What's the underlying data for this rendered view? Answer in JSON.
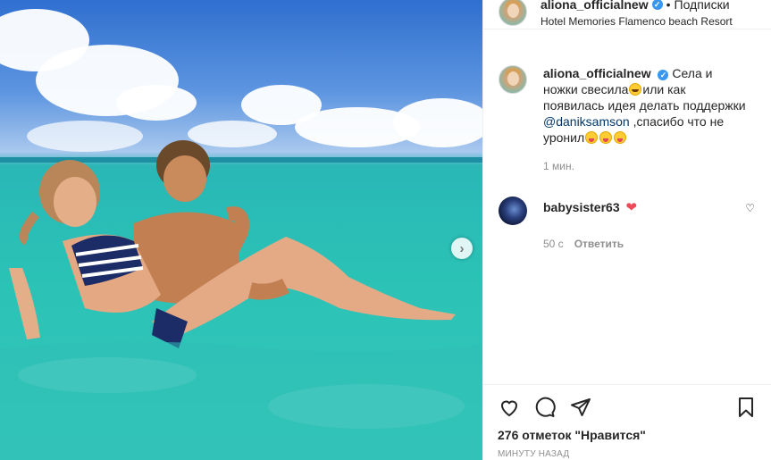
{
  "post": {
    "username": "aliona_officialnew",
    "verified_mark": "✓",
    "dot": "•",
    "follow_label": "Подписки",
    "location": "Hotel Memories Flamenco beach Resort",
    "next_arrow": "›"
  },
  "caption": {
    "username": "aliona_officialnew",
    "text_1": "Села и ножки свесила",
    "text_2": "или как появилась идея делать поддержки",
    "mention": "@daniksamson",
    "text_3": " ,спасибо что не уронил",
    "time": "1 мин."
  },
  "comments": [
    {
      "username": "babysister63",
      "heart": "❤",
      "time": "50 с",
      "reply_label": "Ответить",
      "like_icon": "♡"
    }
  ],
  "actions": {
    "likes_count": "276 отметок \"Нравится\"",
    "posted_ago": "МИНУТУ НАЗАД"
  },
  "icons": {
    "like": "heart-outline-icon",
    "comment": "comment-bubble-icon",
    "share": "paper-plane-icon",
    "save": "bookmark-icon"
  },
  "colors": {
    "link": "#00376b",
    "verified": "#3897f0",
    "meta": "#8e8e8e",
    "heart": "#ed4956"
  }
}
